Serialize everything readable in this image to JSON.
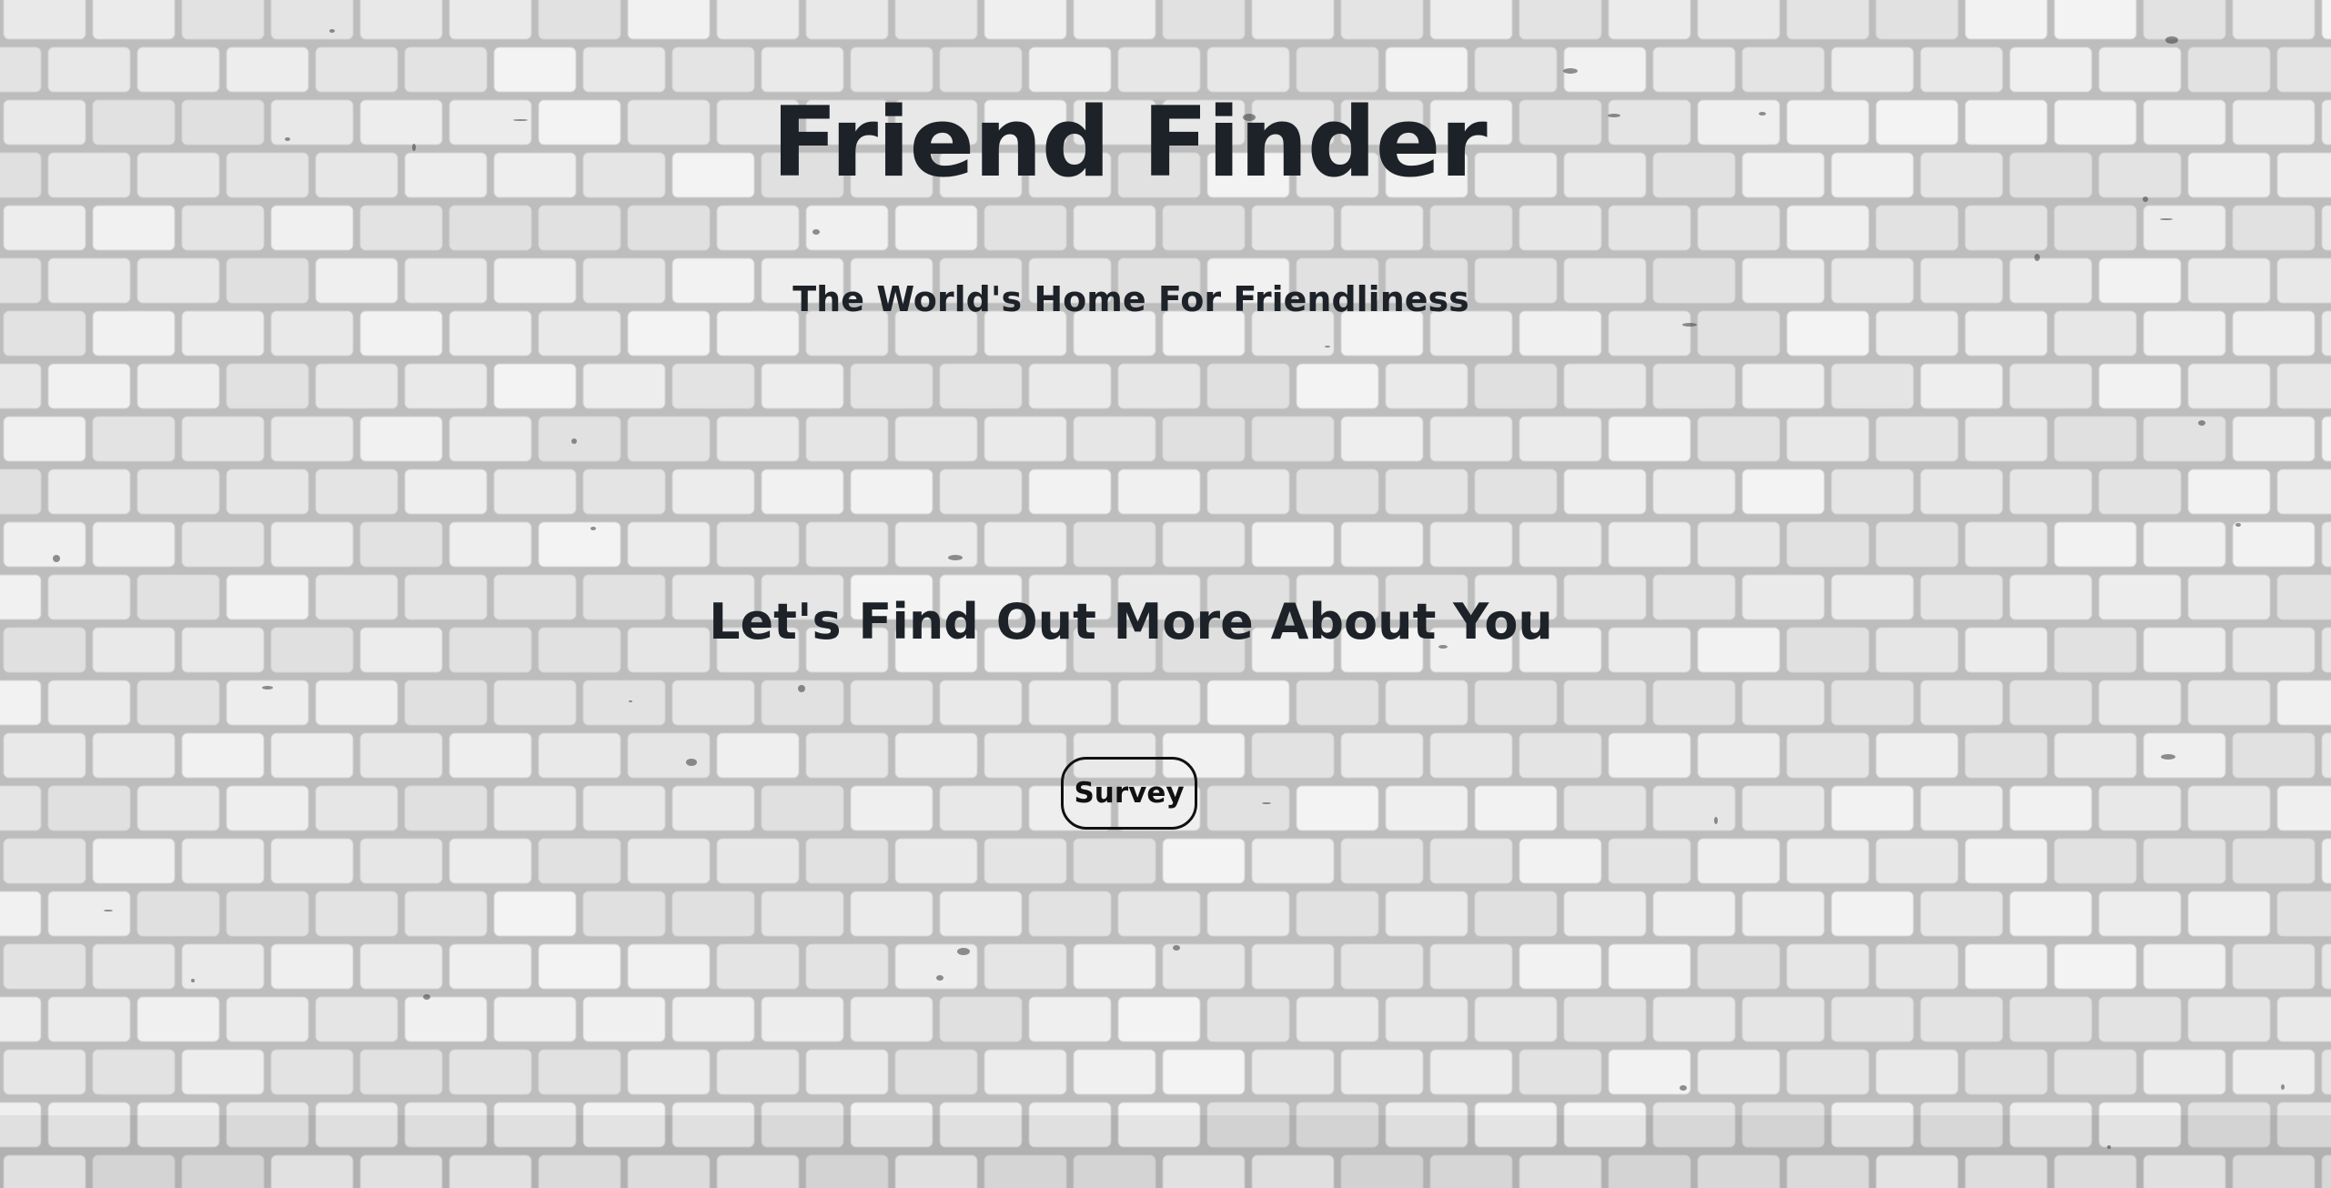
{
  "header": {
    "title": "Friend Finder",
    "tagline": "The World's Home For Friendliness"
  },
  "main": {
    "heading": "Let's Find Out More About You",
    "survey_button_label": "Survey"
  },
  "colors": {
    "text": "#1d2228",
    "wall_mortar": "#bdbdbd",
    "wall_brick": "#ececec"
  }
}
